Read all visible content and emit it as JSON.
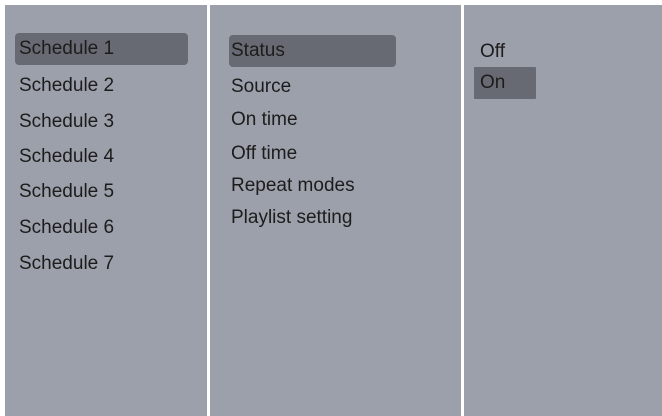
{
  "colors": {
    "panel_background": "#9ca0aa",
    "divider": "#ffffff",
    "highlight": "#676a72",
    "text": "#1c1c1c"
  },
  "schedules": {
    "selected": "Schedule 1",
    "items": [
      {
        "label": "Schedule 1"
      },
      {
        "label": "Schedule 2"
      },
      {
        "label": "Schedule 3"
      },
      {
        "label": "Schedule 4"
      },
      {
        "label": "Schedule 5"
      },
      {
        "label": "Schedule 6"
      },
      {
        "label": "Schedule 7"
      }
    ]
  },
  "settings": {
    "selected": "Status",
    "items": [
      {
        "label": "Status"
      },
      {
        "label": "Source"
      },
      {
        "label": "On time"
      },
      {
        "label": "Off time"
      },
      {
        "label": "Repeat modes"
      },
      {
        "label": "Playlist setting"
      }
    ]
  },
  "status_options": {
    "selected": "On",
    "items": [
      {
        "label": "Off"
      },
      {
        "label": "On"
      }
    ]
  }
}
